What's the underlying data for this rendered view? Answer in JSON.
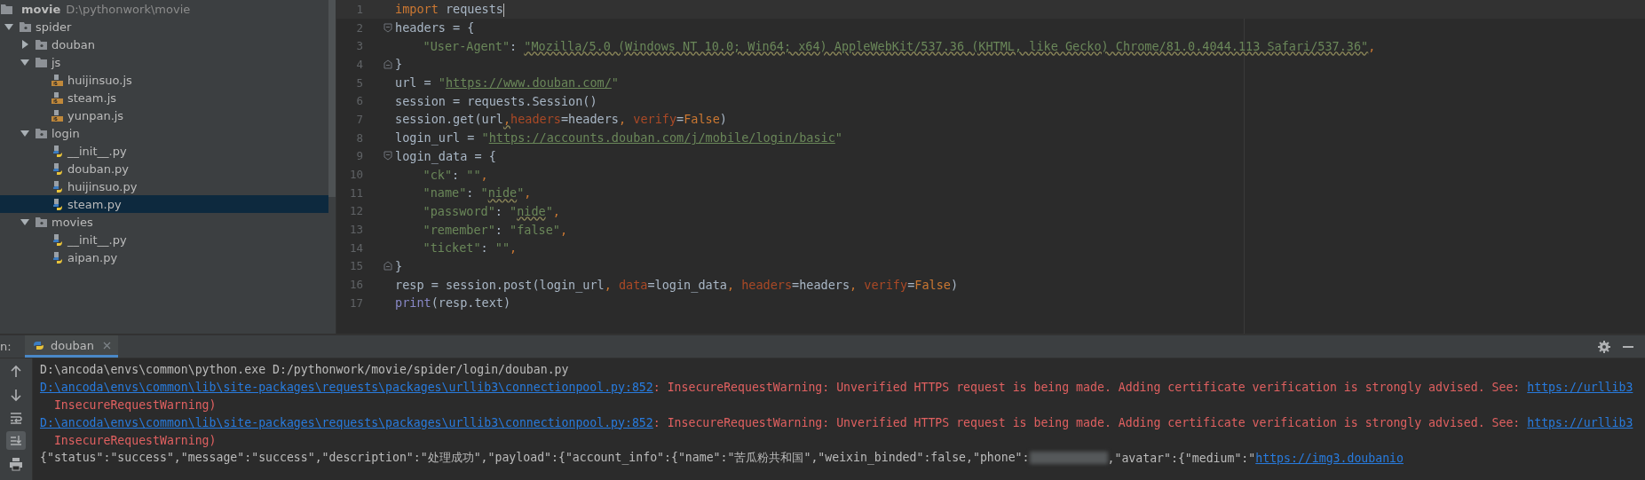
{
  "project_tree": {
    "root": {
      "name": "movie",
      "path": "D:\\pythonwork\\movie"
    },
    "items": [
      {
        "kind": "package",
        "name": "spider",
        "expanded": true,
        "selected": false,
        "children": [
          {
            "kind": "package",
            "name": "douban",
            "expanded": false,
            "selected": false
          },
          {
            "kind": "folder",
            "name": "js",
            "expanded": true,
            "selected": false,
            "children": [
              {
                "kind": "js",
                "name": "huijinsuo.js",
                "selected": false
              },
              {
                "kind": "js",
                "name": "steam.js",
                "selected": false
              },
              {
                "kind": "js",
                "name": "yunpan.js",
                "selected": false
              }
            ]
          },
          {
            "kind": "package",
            "name": "login",
            "expanded": true,
            "selected": false,
            "children": [
              {
                "kind": "py",
                "name": "__init__.py",
                "selected": false
              },
              {
                "kind": "py",
                "name": "douban.py",
                "selected": false
              },
              {
                "kind": "py",
                "name": "huijinsuo.py",
                "selected": false
              },
              {
                "kind": "py",
                "name": "steam.py",
                "selected": true
              }
            ]
          },
          {
            "kind": "package",
            "name": "movies",
            "expanded": true,
            "selected": false,
            "children": [
              {
                "kind": "py",
                "name": "__init__.py",
                "selected": false
              },
              {
                "kind": "py",
                "name": "aipan.py",
                "selected": false
              }
            ]
          }
        ]
      }
    ]
  },
  "editor": {
    "lines": [
      {
        "number": "1",
        "current": true,
        "segments": [
          {
            "kind": "kw",
            "text": "import"
          },
          {
            "kind": "plain",
            "text": " requests"
          }
        ]
      },
      {
        "number": "2",
        "fold_start": true,
        "segments": [
          {
            "kind": "plain",
            "text": "headers = {"
          }
        ]
      },
      {
        "number": "3",
        "indented": true,
        "segments": [
          {
            "kind": "str",
            "text": "\"User-Agent\""
          },
          {
            "kind": "plain",
            "text": ": "
          },
          {
            "kind": "str_warn",
            "text": "\"Mozilla/5.0 (Windows NT 10.0; Win64; x64) AppleWebKit/537.36 (KHTML, like Gecko) Chrome/81.0.4044.113 Safari/537.36\""
          },
          {
            "kind": "punct",
            "text": ","
          }
        ]
      },
      {
        "number": "4",
        "fold_end": true,
        "segments": [
          {
            "kind": "plain",
            "text": "}"
          }
        ]
      },
      {
        "number": "5",
        "segments": [
          {
            "kind": "plain",
            "text": "url = "
          },
          {
            "kind": "str",
            "text": "\""
          },
          {
            "kind": "url",
            "text": "https://www.douban.com/"
          },
          {
            "kind": "str",
            "text": "\""
          }
        ]
      },
      {
        "number": "6",
        "segments": [
          {
            "kind": "plain",
            "text": "session = requests.Session()"
          }
        ]
      },
      {
        "number": "7",
        "segments": [
          {
            "kind": "plain",
            "text": "session.get(url"
          },
          {
            "kind": "punct_warn",
            "text": ","
          },
          {
            "kind": "param",
            "text": "headers"
          },
          {
            "kind": "plain",
            "text": "=headers"
          },
          {
            "kind": "punct",
            "text": ", "
          },
          {
            "kind": "param",
            "text": "verify"
          },
          {
            "kind": "plain",
            "text": "="
          },
          {
            "kind": "kw",
            "text": "False"
          },
          {
            "kind": "plain",
            "text": ")"
          }
        ]
      },
      {
        "number": "8",
        "segments": [
          {
            "kind": "plain",
            "text": "login_url = "
          },
          {
            "kind": "str",
            "text": "\""
          },
          {
            "kind": "url",
            "text": "https://accounts.douban.com/j/mobile/login/basic"
          },
          {
            "kind": "str",
            "text": "\""
          }
        ]
      },
      {
        "number": "9",
        "fold_start": true,
        "segments": [
          {
            "kind": "plain",
            "text": "login_data = {"
          }
        ]
      },
      {
        "number": "10",
        "indented": true,
        "segments": [
          {
            "kind": "str",
            "text": "\"ck\""
          },
          {
            "kind": "plain",
            "text": ": "
          },
          {
            "kind": "str",
            "text": "\"\""
          },
          {
            "kind": "punct",
            "text": ","
          }
        ]
      },
      {
        "number": "11",
        "indented": true,
        "segments": [
          {
            "kind": "str",
            "text": "\"name\""
          },
          {
            "kind": "plain",
            "text": ": "
          },
          {
            "kind": "str",
            "text": "\""
          },
          {
            "kind": "str_warn",
            "text": "nide"
          },
          {
            "kind": "str",
            "text": "\""
          },
          {
            "kind": "punct",
            "text": ","
          }
        ]
      },
      {
        "number": "12",
        "indented": true,
        "segments": [
          {
            "kind": "str",
            "text": "\"password\""
          },
          {
            "kind": "plain",
            "text": ": "
          },
          {
            "kind": "str",
            "text": "\""
          },
          {
            "kind": "str_warn",
            "text": "nide"
          },
          {
            "kind": "str",
            "text": "\""
          },
          {
            "kind": "punct",
            "text": ","
          }
        ]
      },
      {
        "number": "13",
        "indented": true,
        "segments": [
          {
            "kind": "str",
            "text": "\"remember\""
          },
          {
            "kind": "plain",
            "text": ": "
          },
          {
            "kind": "str",
            "text": "\"false\""
          },
          {
            "kind": "punct",
            "text": ","
          }
        ]
      },
      {
        "number": "14",
        "indented": true,
        "segments": [
          {
            "kind": "str",
            "text": "\"ticket\""
          },
          {
            "kind": "plain",
            "text": ": "
          },
          {
            "kind": "str",
            "text": "\"\""
          },
          {
            "kind": "punct",
            "text": ","
          }
        ]
      },
      {
        "number": "15",
        "fold_end": true,
        "segments": [
          {
            "kind": "plain",
            "text": "}"
          }
        ]
      },
      {
        "number": "16",
        "segments": [
          {
            "kind": "plain",
            "text": "resp = session.post(login_url"
          },
          {
            "kind": "punct",
            "text": ", "
          },
          {
            "kind": "param",
            "text": "data"
          },
          {
            "kind": "plain",
            "text": "=login_data"
          },
          {
            "kind": "punct",
            "text": ", "
          },
          {
            "kind": "param",
            "text": "headers"
          },
          {
            "kind": "plain",
            "text": "=headers"
          },
          {
            "kind": "punct",
            "text": ", "
          },
          {
            "kind": "param",
            "text": "verify"
          },
          {
            "kind": "plain",
            "text": "="
          },
          {
            "kind": "kw",
            "text": "False"
          },
          {
            "kind": "plain",
            "text": ")"
          }
        ]
      },
      {
        "number": "17",
        "segments": [
          {
            "kind": "builtin",
            "text": "print"
          },
          {
            "kind": "plain",
            "text": "(resp.text)"
          }
        ]
      }
    ]
  },
  "run_panel": {
    "label": "n:",
    "tabs": [
      {
        "title": "douban",
        "selected": true
      }
    ],
    "toolbar": [
      {
        "kind": "up",
        "active": false
      },
      {
        "kind": "down",
        "active": false
      },
      {
        "kind": "wrap",
        "active": false
      },
      {
        "kind": "scroll_end",
        "active": true
      },
      {
        "kind": "print",
        "active": false
      }
    ],
    "console": [
      [
        {
          "kind": "plain",
          "text": "D:\\ancoda\\envs\\common\\python.exe D:/pythonwork/movie/spider/login/douban.py"
        }
      ],
      [
        {
          "kind": "link",
          "text": "D:\\ancoda\\envs\\common\\lib\\site-packages\\requests\\packages\\urllib3\\connectionpool.py:852"
        },
        {
          "kind": "error",
          "text": ": InsecureRequestWarning: Unverified HTTPS request is being made. Adding certificate verification is strongly advised. See: "
        },
        {
          "kind": "link",
          "text": "https://urllib3"
        }
      ],
      [
        {
          "kind": "error",
          "text": "  InsecureRequestWarning)"
        }
      ],
      [
        {
          "kind": "link",
          "text": "D:\\ancoda\\envs\\common\\lib\\site-packages\\requests\\packages\\urllib3\\connectionpool.py:852"
        },
        {
          "kind": "error",
          "text": ": InsecureRequestWarning: Unverified HTTPS request is being made. Adding certificate verification is strongly advised. See: "
        },
        {
          "kind": "link",
          "text": "https://urllib3"
        }
      ],
      [
        {
          "kind": "error",
          "text": "  InsecureRequestWarning)"
        }
      ],
      [
        {
          "kind": "plain",
          "text": "{\"status\":\"success\",\"message\":\"success\",\"description\":\"处理成功\",\"payload\":{\"account_info\":{\"name\":\"苦瓜粉共和国\",\"weixin_binded\":false,\"phone\":"
        },
        {
          "kind": "redacted"
        },
        {
          "kind": "plain",
          "text": ",\"avatar\":{\"medium\":\""
        },
        {
          "kind": "link",
          "text": "https://img3.doubanio"
        }
      ]
    ]
  }
}
